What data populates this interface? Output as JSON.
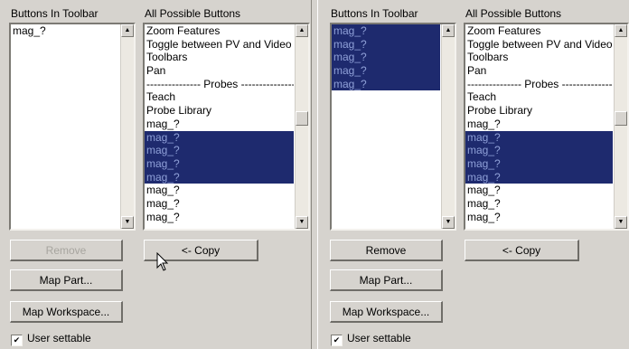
{
  "left_panel": {
    "toolbar_header": "Buttons In Toolbar",
    "all_header": "All Possible Buttons",
    "toolbar_items": [
      {
        "label": "mag_?",
        "selected": false
      }
    ],
    "all_items": [
      {
        "label": "Zoom Features",
        "selected": false
      },
      {
        "label": "Toggle between PV and Video",
        "selected": false
      },
      {
        "label": "Toolbars",
        "selected": false
      },
      {
        "label": "Pan",
        "selected": false
      },
      {
        "label": "--------------- Probes ---------------",
        "selected": false,
        "separator": true
      },
      {
        "label": "Teach",
        "selected": false
      },
      {
        "label": "Probe Library",
        "selected": false
      },
      {
        "label": "mag_?",
        "selected": false
      },
      {
        "label": "mag_?",
        "selected": true
      },
      {
        "label": "mag_?",
        "selected": true
      },
      {
        "label": "mag_?",
        "selected": true
      },
      {
        "label": "mag_?",
        "selected": true
      },
      {
        "label": "mag_?",
        "selected": false
      },
      {
        "label": "mag_?",
        "selected": false
      },
      {
        "label": "mag_?",
        "selected": false
      }
    ],
    "remove_label": "Remove",
    "remove_enabled": false,
    "copy_label": "<- Copy",
    "map_part_label": "Map Part...",
    "map_workspace_label": "Map Workspace...",
    "user_settable_label": "User settable",
    "user_settable_checked": true
  },
  "right_panel": {
    "toolbar_header": "Buttons In Toolbar",
    "all_header": "All Possible Buttons",
    "toolbar_items": [
      {
        "label": "mag_?",
        "selected": true
      },
      {
        "label": "mag_?",
        "selected": true
      },
      {
        "label": "mag_?",
        "selected": true
      },
      {
        "label": "mag_?",
        "selected": true
      },
      {
        "label": "mag_?",
        "selected": true
      }
    ],
    "all_items": [
      {
        "label": "Zoom Features",
        "selected": false
      },
      {
        "label": "Toggle between PV and Video",
        "selected": false
      },
      {
        "label": "Toolbars",
        "selected": false
      },
      {
        "label": "Pan",
        "selected": false
      },
      {
        "label": "--------------- Probes ---------------",
        "selected": false,
        "separator": true
      },
      {
        "label": "Teach",
        "selected": false
      },
      {
        "label": "Probe Library",
        "selected": false
      },
      {
        "label": "mag_?",
        "selected": false
      },
      {
        "label": "mag_?",
        "selected": true
      },
      {
        "label": "mag_?",
        "selected": true
      },
      {
        "label": "mag_?",
        "selected": true
      },
      {
        "label": "mag_?",
        "selected": true
      },
      {
        "label": "mag_?",
        "selected": false
      },
      {
        "label": "mag_?",
        "selected": false
      },
      {
        "label": "mag_?",
        "selected": false
      }
    ],
    "remove_label": "Remove",
    "remove_enabled": true,
    "copy_label": "<- Copy",
    "map_part_label": "Map Part...",
    "map_workspace_label": "Map Workspace...",
    "user_settable_label": "User settable",
    "user_settable_checked": true
  },
  "icons": {
    "scroll_up": "scroll-up-arrow-icon",
    "scroll_down": "scroll-down-arrow-icon",
    "checkmark": "checkmark-icon",
    "cursor": "mouse-pointer-icon"
  },
  "colors": {
    "window_bg": "#d6d3ce",
    "selection_bg": "#1e2a6e",
    "selection_text": "#8fa0d8",
    "disabled_text": "#a7a59f"
  }
}
